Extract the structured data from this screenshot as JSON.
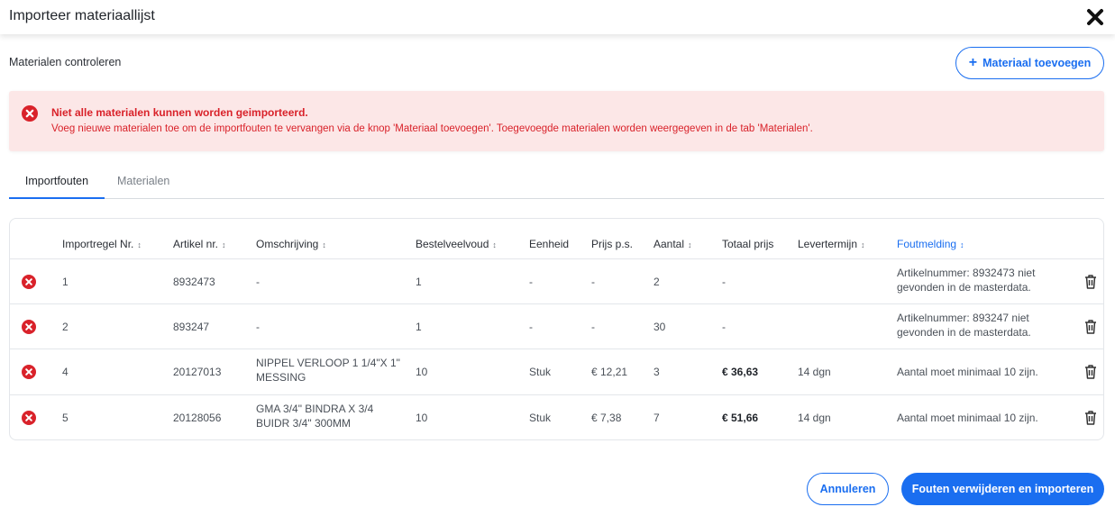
{
  "dialog": {
    "title": "Importeer materiaallijst",
    "close_icon": "close-icon"
  },
  "subtitle": "Materialen controleren",
  "add_button": {
    "label": "Materiaal toevoegen",
    "icon": "plus-icon"
  },
  "alert": {
    "title": "Niet alle materialen kunnen worden geimporteerd.",
    "message": "Voeg nieuwe materialen toe om de importfouten te vervangen via de knop 'Materiaal toevoegen'. Toegevoegde materialen worden weergegeven in de tab 'Materialen'.",
    "color": "#d9222a",
    "background": "#fce7e7"
  },
  "tabs": [
    {
      "label": "Importfouten",
      "active": true
    },
    {
      "label": "Materialen",
      "active": false
    }
  ],
  "table": {
    "columns": [
      {
        "label": "Importregel Nr.",
        "sortable": true
      },
      {
        "label": "Artikel nr.",
        "sortable": true
      },
      {
        "label": "Omschrijving",
        "sortable": true
      },
      {
        "label": "Bestelveelvoud",
        "sortable": true
      },
      {
        "label": "Eenheid",
        "sortable": false
      },
      {
        "label": "Prijs p.s.",
        "sortable": false
      },
      {
        "label": "Aantal",
        "sortable": true
      },
      {
        "label": "Totaal prijs",
        "sortable": false
      },
      {
        "label": "Levertermijn",
        "sortable": true
      },
      {
        "label": "Foutmelding",
        "sortable": true,
        "highlighted": true
      }
    ],
    "sort_glyph": "↕",
    "rows": [
      {
        "nr": "1",
        "artikel": "8932473",
        "omschrijving": "-",
        "bestelveelvoud": "1",
        "eenheid": "-",
        "prijs": "-",
        "aantal": "2",
        "totaal": "-",
        "levertermijn": "",
        "fout": "Artikelnummer: 8932473 niet gevonden in de masterdata."
      },
      {
        "nr": "2",
        "artikel": "893247",
        "omschrijving": "-",
        "bestelveelvoud": "1",
        "eenheid": "-",
        "prijs": "-",
        "aantal": "30",
        "totaal": "-",
        "levertermijn": "",
        "fout": "Artikelnummer: 893247 niet gevonden in de masterdata."
      },
      {
        "nr": "4",
        "artikel": "20127013",
        "omschrijving": "NIPPEL VERLOOP 1 1/4\"X 1\" MESSING",
        "bestelveelvoud": "10",
        "eenheid": "Stuk",
        "prijs": "€ 12,21",
        "aantal": "3",
        "totaal": "€ 36,63",
        "levertermijn": "14 dgn",
        "fout": "Aantal moet minimaal 10 zijn."
      },
      {
        "nr": "5",
        "artikel": "20128056",
        "omschrijving": "GMA  3/4\" BINDRA X 3/4 BUIDR 3/4\"  300MM",
        "bestelveelvoud": "10",
        "eenheid": "Stuk",
        "prijs": "€ 7,38",
        "aantal": "7",
        "totaal": "€ 51,66",
        "levertermijn": "14 dgn",
        "fout": "Aantal moet minimaal 10 zijn."
      }
    ]
  },
  "footer": {
    "cancel_label": "Annuleren",
    "primary_label": "Fouten verwijderen en importeren",
    "accent_color": "#1a6ef0"
  }
}
